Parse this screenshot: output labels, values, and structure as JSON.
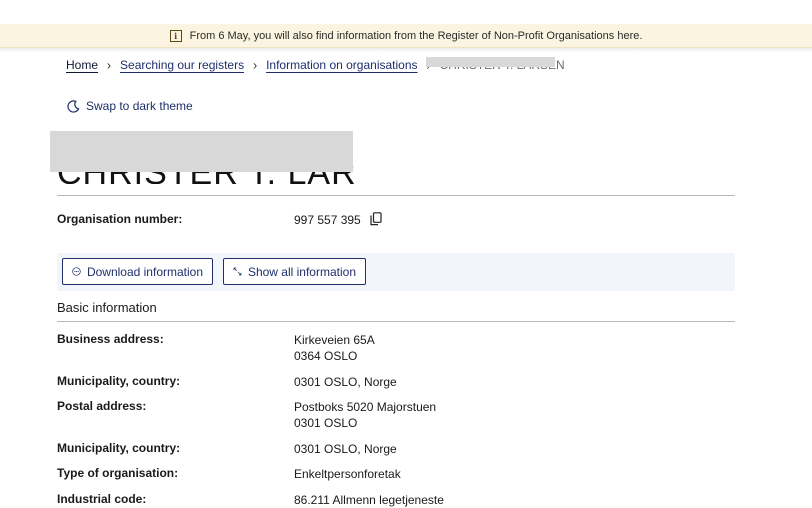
{
  "top_strip": {
    "left_partial": "",
    "right_partial": ""
  },
  "banner": {
    "text": "From 6 May, you will also find information from the Register of Non-Profit Organisations here."
  },
  "breadcrumb": {
    "home": "Home",
    "registers": "Searching our registers",
    "organisations": "Information on organisations",
    "current": "CHRISTER T. LARSEN"
  },
  "theme_toggle": {
    "label": "Swap to dark theme"
  },
  "page_title": "CHRISTER T. LARSEN",
  "org_number": {
    "label": "Organisation number:",
    "value": "997 557 395"
  },
  "actions": {
    "download": "Download information",
    "show_all": "Show all information"
  },
  "basic_info": {
    "title": "Basic information",
    "business_address": {
      "label": "Business address:",
      "line1": "Kirkeveien 65A",
      "line2": "0364 OSLO"
    },
    "municipality1": {
      "label": "Municipality, country:",
      "value": "0301 OSLO, Norge"
    },
    "postal_address": {
      "label": "Postal address:",
      "line1": "Postboks 5020 Majorstuen",
      "line2": "0301 OSLO"
    },
    "municipality2": {
      "label": "Municipality, country:",
      "value": "0301 OSLO, Norge"
    },
    "org_type": {
      "label": "Type of organisation:",
      "value": "Enkeltpersonforetak"
    },
    "industrial_code": {
      "label": "Industrial code:",
      "value": "86.211 Allmenn legetjeneste"
    }
  },
  "colors": {
    "accent": "#1f2f6b",
    "banner_bg": "#fbf4e0",
    "action_bar_bg": "#f2f5fb",
    "redaction": "#d8d8d8"
  },
  "icons": {
    "banner": "info-icon",
    "breadcrumb_separator": "chevron-right-icon",
    "theme": "moon-icon",
    "copy": "copy-icon",
    "download": "ellipsis-circle-icon",
    "expand": "expand-arrows-icon"
  }
}
